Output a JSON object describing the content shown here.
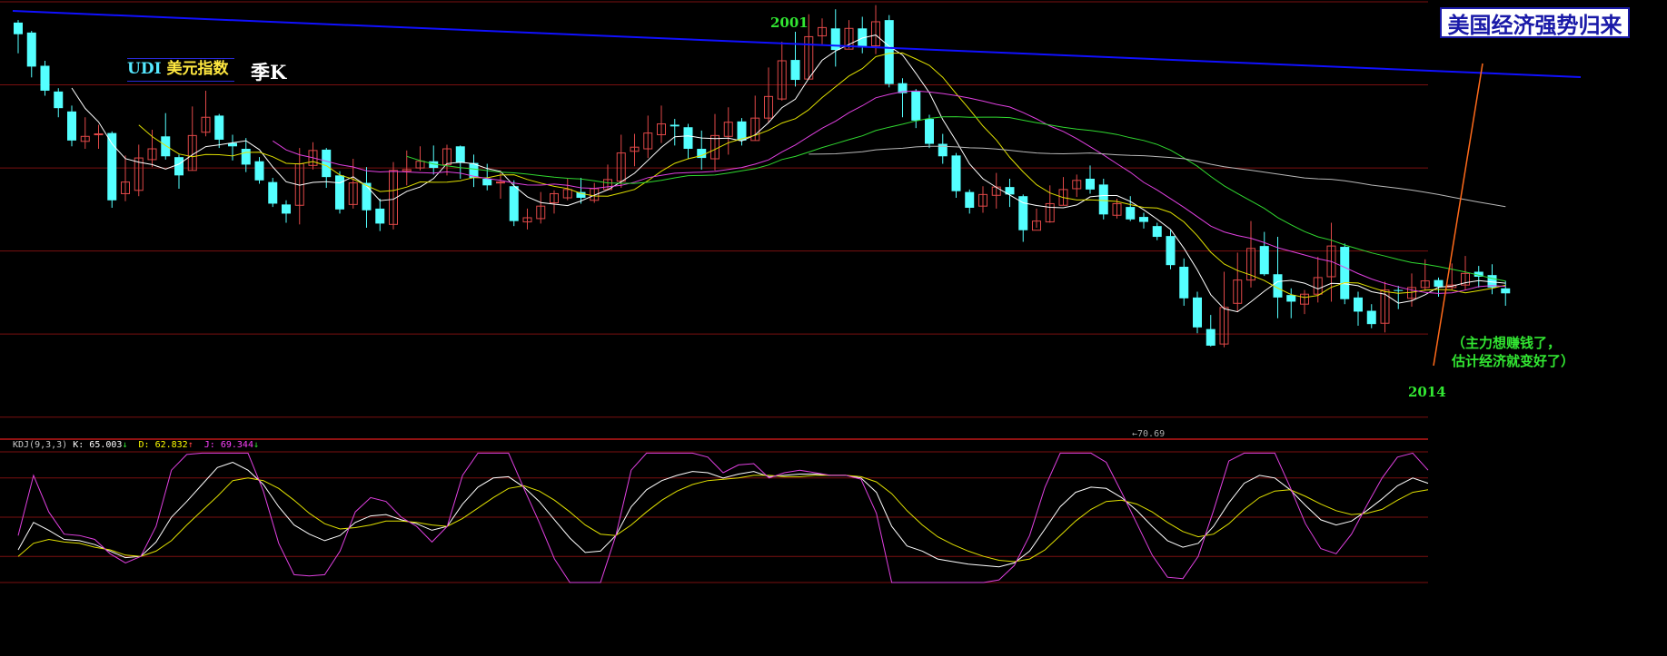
{
  "title_box": "美国经济强势归来",
  "index_label": {
    "code": "UDI",
    "name": "美元指数"
  },
  "period_label": "季K",
  "peak_year_label": "2001",
  "current_year_label": "2014",
  "note": {
    "line1": "（主力想赚钱了，",
    "line2": "估计经济就变好了）"
  },
  "min_label": "←70.69",
  "kdj_header": {
    "name": "KDJ(9,3,3)",
    "k_text": "K: 65.003",
    "k_arrow": "↓",
    "d_text": "D: 62.832",
    "d_arrow": "↑",
    "j_text": "J: 69.344",
    "j_arrow": "↓"
  },
  "colors": {
    "up": "#e04848",
    "down": "#54ffff",
    "ma_white": "#ffffff",
    "ma_yellow": "#e0e000",
    "ma_magenta": "#e040e0",
    "ma_green": "#30d830",
    "ma_gray": "#b8b8b8",
    "grid": "#7a1010",
    "trend_line": "#1010ff",
    "arrow": "#ff6a1a",
    "kdj_k": "#ffffff",
    "kdj_d": "#e0e000",
    "kdj_j": "#e040e0"
  },
  "chart_data": {
    "type": "candlestick",
    "price_range": [
      70,
      122
    ],
    "gridlines": [
      72,
      82,
      92,
      102,
      112,
      122
    ],
    "candles": [
      [
        119.5,
        118.1,
        119.8,
        115.8
      ],
      [
        118.3,
        114.2,
        118.5,
        112.9
      ],
      [
        114.3,
        111.3,
        114.9,
        110.7
      ],
      [
        111.2,
        109.2,
        111.6,
        108.1
      ],
      [
        108.8,
        105.3,
        109.5,
        104.6
      ],
      [
        105.2,
        105.8,
        108.1,
        104.3
      ],
      [
        106.0,
        106.1,
        107.2,
        104.3
      ],
      [
        106.2,
        98.1,
        106.4,
        97.2
      ],
      [
        98.9,
        100.3,
        103.5,
        98.0
      ],
      [
        99.3,
        103.2,
        104.8,
        98.6
      ],
      [
        103.0,
        104.3,
        106.6,
        102.1
      ],
      [
        105.8,
        103.4,
        108.6,
        103.0
      ],
      [
        103.3,
        101.1,
        103.6,
        99.5
      ],
      [
        101.7,
        105.9,
        109.4,
        101.7
      ],
      [
        106.3,
        108.1,
        111.3,
        105.8
      ],
      [
        108.3,
        105.4,
        108.5,
        104.4
      ],
      [
        105.0,
        104.6,
        106.0,
        102.9
      ],
      [
        104.3,
        102.4,
        105.6,
        101.5
      ],
      [
        102.8,
        100.5,
        103.3,
        100.1
      ],
      [
        100.3,
        97.7,
        100.8,
        97.3
      ],
      [
        97.6,
        96.5,
        98.1,
        95.4
      ],
      [
        97.5,
        102.5,
        104.4,
        95.2
      ],
      [
        102.3,
        104.1,
        105.1,
        101.8
      ],
      [
        104.2,
        100.9,
        104.4,
        99.6
      ],
      [
        101.1,
        97.0,
        101.6,
        96.5
      ],
      [
        97.6,
        100.2,
        103.1,
        97.1
      ],
      [
        100.2,
        96.9,
        102.1,
        94.8
      ],
      [
        97.1,
        95.3,
        98.3,
        94.4
      ],
      [
        95.2,
        101.7,
        102.7,
        94.6
      ],
      [
        101.6,
        101.8,
        104.1,
        99.9
      ],
      [
        102.0,
        102.8,
        104.6,
        101.7
      ],
      [
        102.8,
        102.0,
        104.7,
        101.2
      ],
      [
        102.4,
        104.3,
        104.8,
        101.1
      ],
      [
        104.6,
        102.6,
        104.7,
        100.7
      ],
      [
        102.6,
        100.8,
        103.6,
        99.7
      ],
      [
        100.7,
        99.9,
        102.5,
        99.3
      ],
      [
        100.3,
        100.3,
        101.7,
        98.3
      ],
      [
        99.8,
        95.6,
        100.5,
        95.0
      ],
      [
        95.5,
        96.0,
        97.1,
        94.6
      ],
      [
        95.9,
        97.4,
        99.1,
        95.3
      ],
      [
        97.8,
        98.9,
        99.3,
        96.5
      ],
      [
        98.4,
        99.4,
        100.7,
        98.1
      ],
      [
        99.1,
        98.4,
        100.8,
        97.7
      ],
      [
        98.1,
        99.5,
        100.2,
        97.8
      ],
      [
        99.4,
        100.6,
        102.4,
        99.3
      ],
      [
        100.4,
        103.8,
        106.0,
        99.6
      ],
      [
        104.0,
        104.5,
        106.1,
        102.2
      ],
      [
        104.3,
        106.2,
        108.3,
        103.2
      ],
      [
        106.0,
        107.3,
        109.5,
        105.0
      ],
      [
        107.2,
        107.0,
        107.9,
        104.7
      ],
      [
        106.9,
        104.3,
        107.3,
        103.1
      ],
      [
        104.3,
        103.2,
        106.5,
        101.8
      ],
      [
        103.1,
        105.9,
        108.5,
        101.7
      ],
      [
        105.8,
        107.5,
        109.3,
        103.6
      ],
      [
        107.6,
        105.3,
        108.0,
        104.7
      ],
      [
        105.3,
        108.0,
        110.7,
        105.3
      ],
      [
        108.0,
        110.6,
        114.1,
        107.4
      ],
      [
        110.3,
        114.9,
        117.2,
        110.1
      ],
      [
        115.0,
        112.6,
        118.4,
        111.8
      ],
      [
        112.7,
        117.8,
        120.5,
        112.7
      ],
      [
        117.9,
        118.9,
        120.0,
        116.9
      ],
      [
        118.8,
        116.2,
        121.1,
        114.2
      ],
      [
        116.3,
        118.8,
        119.8,
        116.4
      ],
      [
        118.8,
        116.5,
        120.2,
        115.8
      ],
      [
        116.7,
        119.6,
        121.6,
        115.7
      ],
      [
        119.8,
        112.1,
        120.4,
        111.7
      ],
      [
        112.2,
        111.0,
        112.8,
        108.1
      ],
      [
        111.2,
        107.7,
        111.5,
        106.8
      ],
      [
        107.9,
        104.9,
        108.4,
        104.4
      ],
      [
        104.9,
        103.4,
        106.1,
        102.5
      ],
      [
        103.5,
        99.2,
        103.8,
        98.4
      ],
      [
        99.1,
        97.2,
        99.4,
        96.5
      ],
      [
        97.4,
        98.8,
        99.8,
        96.6
      ],
      [
        98.7,
        99.7,
        101.4,
        97.1
      ],
      [
        99.7,
        98.8,
        100.7,
        97.3
      ],
      [
        98.6,
        94.5,
        98.8,
        93.1
      ],
      [
        94.5,
        95.6,
        97.1,
        94.8
      ],
      [
        95.5,
        97.7,
        99.9,
        95.4
      ],
      [
        97.5,
        99.4,
        100.9,
        97.5
      ],
      [
        99.5,
        100.5,
        101.2,
        98.5
      ],
      [
        100.7,
        99.4,
        102.3,
        98.9
      ],
      [
        100.0,
        96.4,
        100.7,
        95.8
      ],
      [
        96.3,
        97.7,
        98.3,
        95.9
      ],
      [
        97.3,
        95.8,
        98.6,
        95.6
      ],
      [
        96.1,
        95.5,
        96.6,
        94.7
      ],
      [
        95.0,
        93.7,
        95.4,
        93.3
      ],
      [
        93.8,
        90.3,
        94.5,
        89.8
      ],
      [
        90.1,
        86.3,
        91.1,
        85.4
      ],
      [
        86.4,
        82.8,
        87.1,
        82.1
      ],
      [
        82.6,
        80.6,
        84.3,
        80.5
      ],
      [
        80.8,
        85.2,
        89.5,
        80.4
      ],
      [
        85.7,
        88.5,
        91.8,
        84.7
      ],
      [
        88.5,
        92.3,
        95.6,
        87.6
      ],
      [
        92.6,
        89.2,
        94.3,
        89.0
      ],
      [
        89.2,
        86.4,
        93.7,
        83.9
      ],
      [
        86.7,
        85.9,
        87.5,
        83.9
      ],
      [
        85.6,
        86.8,
        87.3,
        84.4
      ],
      [
        86.8,
        88.8,
        91.3,
        85.8
      ],
      [
        88.9,
        92.6,
        95.4,
        85.9
      ],
      [
        92.5,
        86.2,
        92.9,
        85.6
      ],
      [
        86.4,
        84.7,
        87.1,
        83.0
      ],
      [
        84.8,
        83.2,
        85.6,
        82.7
      ],
      [
        83.3,
        87.3,
        88.3,
        82.2
      ],
      [
        87.3,
        87.2,
        87.8,
        85.0
      ],
      [
        86.3,
        87.6,
        89.3,
        85.3
      ],
      [
        87.6,
        88.4,
        91.0,
        87.2
      ],
      [
        88.5,
        87.7,
        88.8,
        86.5
      ],
      [
        87.6,
        87.9,
        90.5,
        87.3
      ],
      [
        87.9,
        89.3,
        91.4,
        87.3
      ],
      [
        89.5,
        88.9,
        90.2,
        87.6
      ],
      [
        89.1,
        87.6,
        90.4,
        86.8
      ],
      [
        87.5,
        86.9,
        88.4,
        85.4
      ]
    ],
    "kdj_range": [
      0,
      100
    ],
    "k": [
      25,
      46,
      40,
      33,
      32,
      29,
      24,
      19,
      20,
      31,
      50,
      62,
      75,
      88,
      92,
      86,
      75,
      58,
      44,
      37,
      32,
      36,
      46,
      51,
      52,
      48,
      45,
      40,
      43,
      60,
      73,
      80,
      81,
      73,
      62,
      48,
      34,
      23,
      24,
      36,
      58,
      71,
      78,
      82,
      85,
      84,
      80,
      83,
      85,
      81,
      82,
      83,
      83,
      82,
      82,
      80,
      69,
      43,
      28,
      24,
      18,
      16,
      14,
      13,
      12,
      15,
      24,
      41,
      58,
      69,
      73,
      72,
      65,
      55,
      43,
      32,
      27,
      30,
      43,
      61,
      76,
      82,
      80,
      71,
      59,
      48,
      44,
      47,
      55,
      64,
      74,
      80,
      76
    ],
    "d": [
      20,
      30,
      33,
      31,
      30,
      27,
      25,
      21,
      20,
      24,
      32,
      44,
      55,
      66,
      78,
      80,
      78,
      72,
      63,
      53,
      45,
      41,
      42,
      44,
      47,
      47,
      46,
      44,
      43,
      49,
      57,
      65,
      72,
      74,
      70,
      63,
      54,
      44,
      37,
      36,
      44,
      54,
      63,
      70,
      75,
      78,
      79,
      80,
      82,
      82,
      81,
      81,
      82,
      82,
      82,
      81,
      77,
      68,
      55,
      44,
      35,
      29,
      24,
      20,
      17,
      16,
      18,
      25,
      36,
      47,
      56,
      62,
      63,
      60,
      54,
      46,
      39,
      35,
      37,
      45,
      56,
      65,
      70,
      71,
      66,
      60,
      55,
      52,
      53,
      56,
      63,
      69,
      71
    ],
    "j": [
      36,
      82,
      54,
      37,
      36,
      33,
      22,
      15,
      20,
      43,
      86,
      98,
      99,
      99,
      99,
      99,
      70,
      30,
      6,
      5,
      6,
      24,
      54,
      65,
      62,
      50,
      43,
      31,
      43,
      82,
      99,
      99,
      99,
      72,
      46,
      18,
      0,
      0,
      0,
      36,
      86,
      99,
      99,
      99,
      99,
      96,
      84,
      90,
      91,
      80,
      84,
      86,
      84,
      82,
      82,
      79,
      53,
      0,
      0,
      0,
      0,
      0,
      0,
      0,
      2,
      13,
      36,
      73,
      99,
      99,
      99,
      92,
      69,
      45,
      21,
      4,
      3,
      20,
      55,
      93,
      99,
      99,
      99,
      73,
      45,
      26,
      22,
      37,
      59,
      80,
      96,
      99,
      86
    ]
  }
}
